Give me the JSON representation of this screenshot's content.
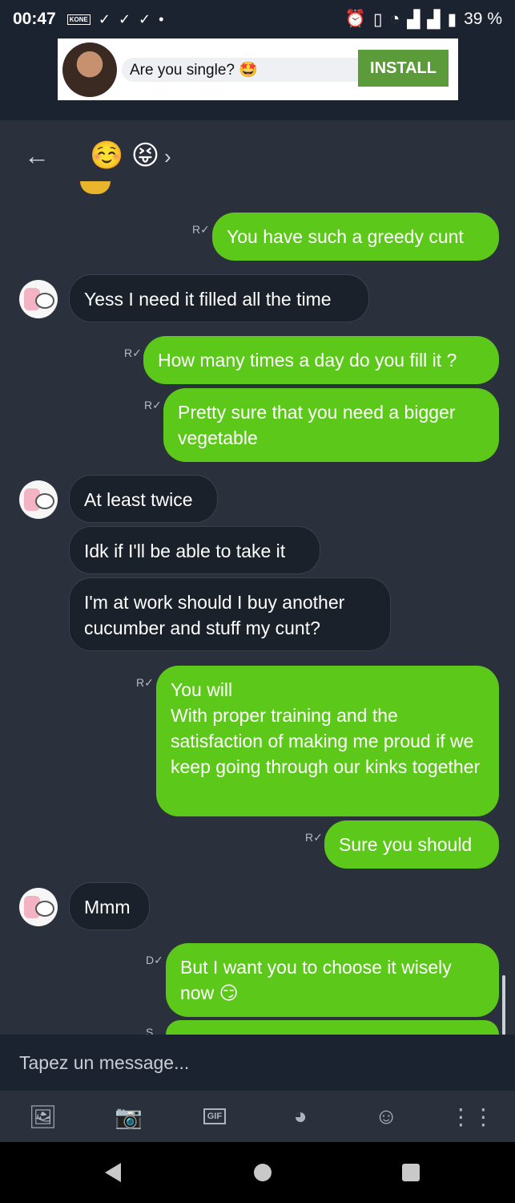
{
  "status": {
    "time": "00:47",
    "battery": "39 %",
    "carrier_badge": "KONE"
  },
  "ad": {
    "text": "Are you single? 🤩",
    "install": "INSTALL"
  },
  "header": {
    "title_emojis": "☺️ 😝"
  },
  "receipts": {
    "read": "R",
    "delivered": "D",
    "sent": "S"
  },
  "messages": [
    {
      "dir": "out",
      "text": "You have such a greedy cunt"
    },
    {
      "dir": "in",
      "text": "Yess I need it filled all the time"
    },
    {
      "dir": "out",
      "text": "How many times a day do you fill it ?"
    },
    {
      "dir": "out",
      "text": "Pretty sure that you need a bigger vegetable"
    },
    {
      "dir": "in",
      "text": "At least twice"
    },
    {
      "dir": "in",
      "text": "Idk if I'll be able to take it"
    },
    {
      "dir": "in",
      "text": "I'm at work should I buy another cucumber and stuff my cunt?"
    },
    {
      "dir": "out",
      "text": "You will\nWith proper training and the satisfaction of making me proud if we keep going through our kinks together"
    },
    {
      "dir": "out",
      "text": "Sure you should"
    },
    {
      "dir": "in",
      "text": "Mmm"
    },
    {
      "dir": "out",
      "text": "But I want you to choose it wisely now 😏"
    }
  ],
  "composer": {
    "placeholder": "Tapez un message..."
  },
  "toolbar": {
    "gif_label": "GIF"
  }
}
